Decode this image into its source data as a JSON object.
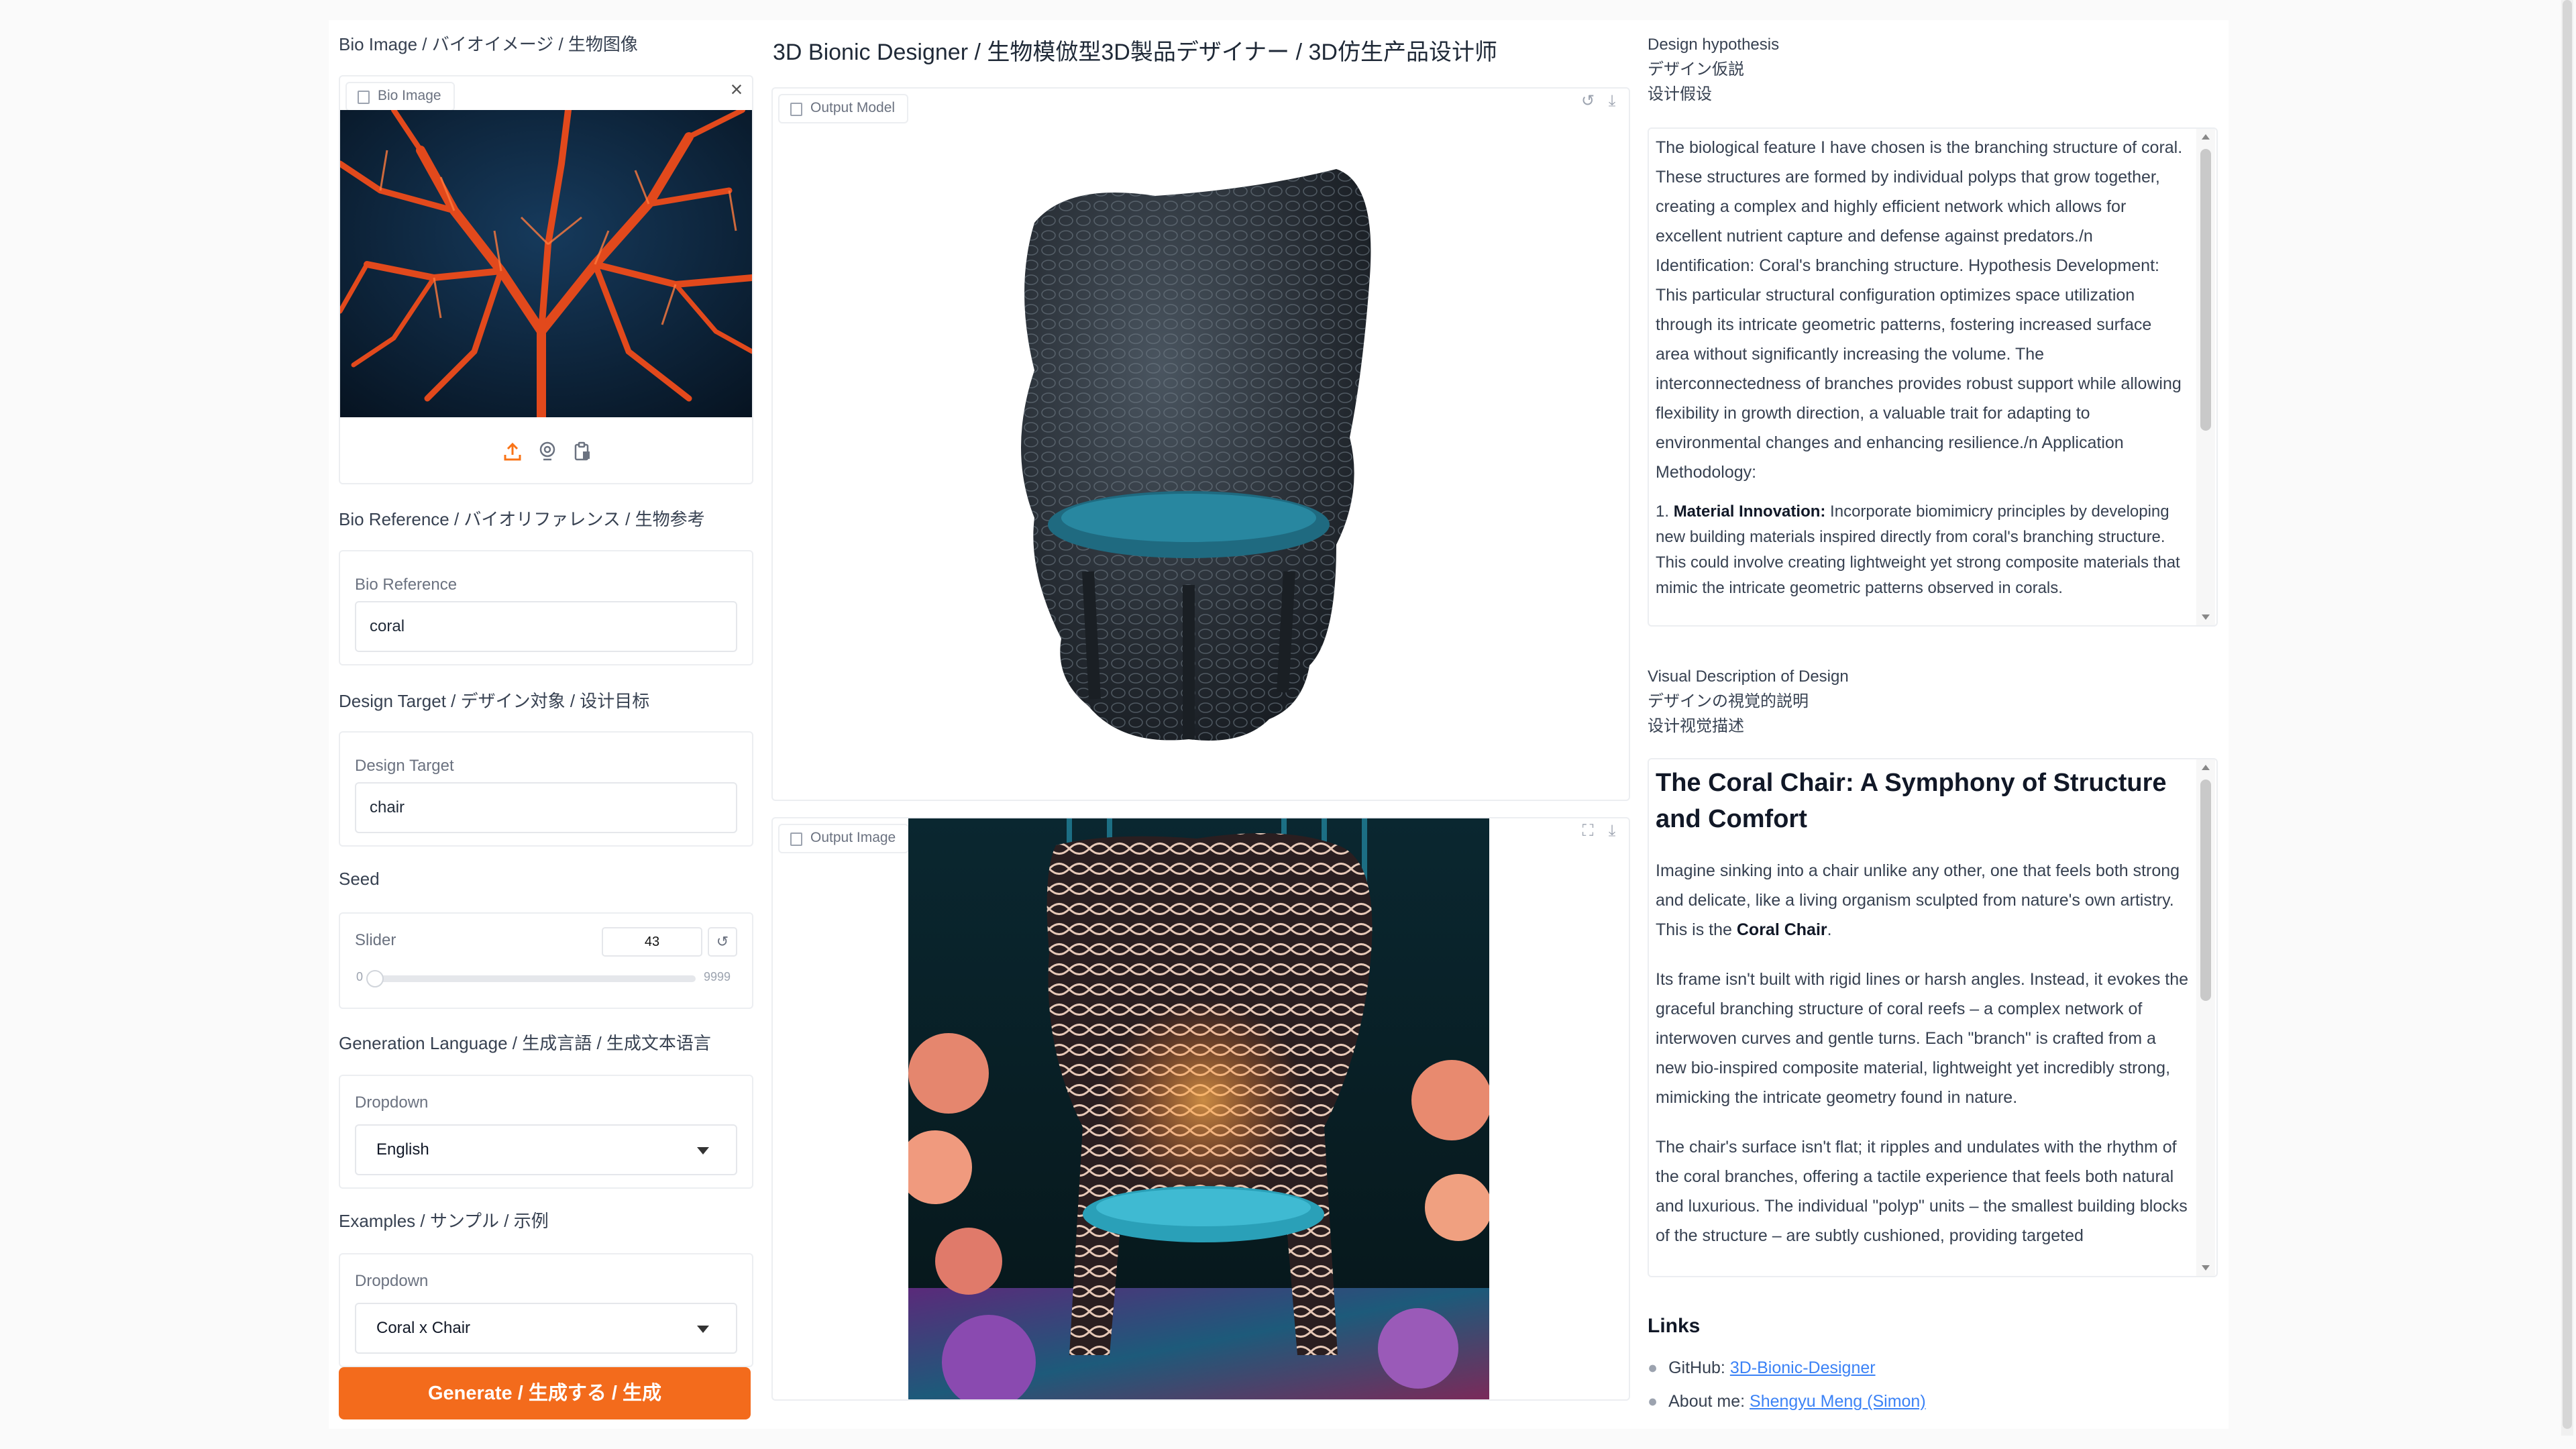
{
  "left_panel": {
    "bio_image": {
      "section_title": "Bio Image / バイオイメージ / 生物图像",
      "tag": "Bio Image"
    },
    "bio_reference": {
      "section_title": "Bio Reference / バイオリファレンス / 生物参考",
      "label": "Bio Reference",
      "value": "coral"
    },
    "design_target": {
      "section_title": "Design Target / デザイン対象 / 设计目标",
      "label": "Design Target",
      "value": "chair"
    },
    "seed": {
      "section_title": "Seed",
      "label": "Slider",
      "value": "43",
      "min": "0",
      "max": "9999",
      "fraction": 0.0043
    },
    "generation_language": {
      "section_title": "Generation Language / 生成言語 / 生成文本语言",
      "label": "Dropdown",
      "value": "English"
    },
    "examples": {
      "section_title": "Examples / サンプル / 示例",
      "label": "Dropdown",
      "value": "Coral x Chair"
    },
    "generate_label": "Generate / 生成する / 生成"
  },
  "center_panel": {
    "title": "3D Bionic Designer / 生物模倣型3D製品デザイナー / 3D仿生产品设计师",
    "output_model_tag": "Output Model",
    "output_image_tag": "Output Image"
  },
  "right_panel": {
    "hypothesis": {
      "title_en": "Design hypothesis",
      "title_ja": "デザイン仮説",
      "title_zh": "设计假设",
      "paragraph": "The biological feature I have chosen is the branching structure of coral. These structures are formed by individual polyps that grow together, creating a complex and highly efficient network which allows for excellent nutrient capture and defense against predators./n Identification: Coral's branching structure. Hypothesis Development: This particular structural configuration optimizes space utilization through its intricate geometric patterns, fostering increased surface area without significantly increasing the volume. The interconnectedness of branches provides robust support while allowing flexibility in growth direction, a valuable trait for adapting to environmental changes and enhancing resilience./n Application Methodology:",
      "item_number": "1.",
      "item_bold": "Material Innovation:",
      "item_text": "Incorporate biomimicry principles by developing new building materials inspired directly from coral's branching structure. This could involve creating lightweight yet strong composite materials that mimic the intricate geometric patterns observed in corals."
    },
    "visual": {
      "title_en": "Visual Description of Design",
      "title_ja": "デザインの視覚的説明",
      "title_zh": "设计视觉描述",
      "heading": "The Coral Chair: A Symphony of Structure and Comfort",
      "p1_before": "Imagine sinking into a chair unlike any other, one that feels both strong and delicate, like a living organism sculpted from nature's own artistry. This is the ",
      "p1_bold": "Coral Chair",
      "p1_after": ".",
      "p2": "Its frame isn't built with rigid lines or harsh angles. Instead, it evokes the graceful branching structure of coral reefs – a complex network of interwoven curves and gentle turns. Each \"branch\" is crafted from a new bio-inspired composite material, lightweight yet incredibly strong, mimicking the intricate geometry found in nature.",
      "p3": "The chair's surface isn't flat; it ripples and undulates with the rhythm of the coral branches, offering a tactile experience that feels both natural and luxurious. The individual \"polyp\" units – the smallest building blocks of the structure – are subtly cushioned, providing targeted"
    },
    "links": {
      "title": "Links",
      "github_label": "GitHub:",
      "github_link": "3D-Bionic-Designer",
      "about_label": "About me:",
      "about_link": "Shengyu Meng (Simon)"
    }
  }
}
